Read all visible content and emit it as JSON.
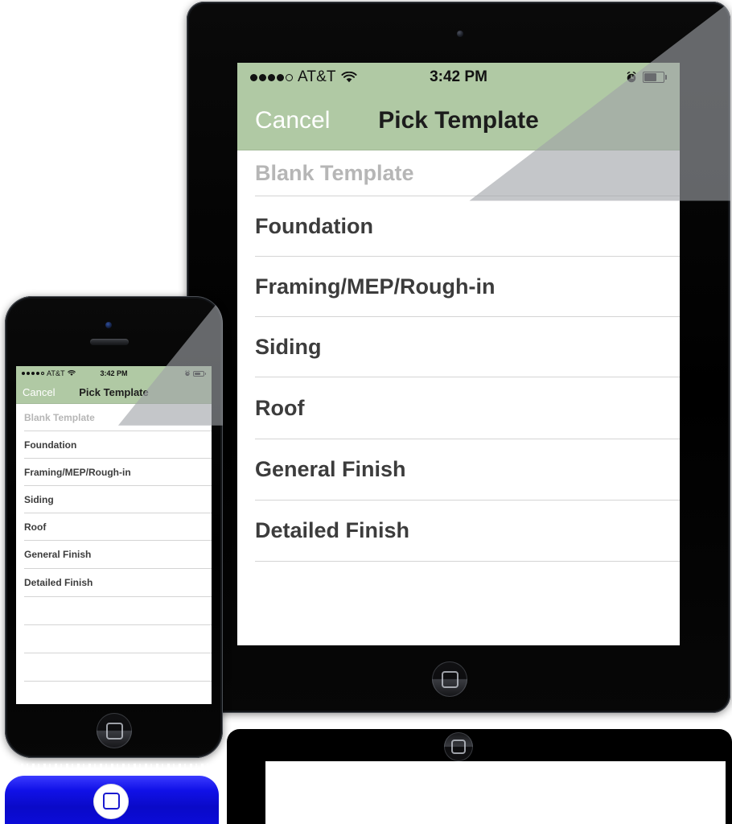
{
  "colors": {
    "navbar_green": "#b0c9a4",
    "row_text": "#3c3c3c",
    "placeholder_text": "#b6b6b6",
    "cancel_text": "#ffffff",
    "separator": "#d4d4d4",
    "device_body": "#000000",
    "reflection_glow_blue": "#0b0bd8"
  },
  "status_bar": {
    "signal_dots_filled": 4,
    "signal_dots_total": 5,
    "carrier": "AT&T",
    "wifi_icon": "wifi-icon",
    "time": "3:42 PM",
    "alarm_icon": "alarm-clock-icon",
    "battery_icon": "battery-icon",
    "battery_percent": 60
  },
  "navbar": {
    "cancel_label": "Cancel",
    "title": "Pick Template"
  },
  "template_list": {
    "rows": [
      {
        "label": "Blank Template",
        "style": "placeholder"
      },
      {
        "label": "Foundation",
        "style": "normal"
      },
      {
        "label": "Framing/MEP/Rough-in",
        "style": "normal"
      },
      {
        "label": "Siding",
        "style": "normal"
      },
      {
        "label": "Roof",
        "style": "normal"
      },
      {
        "label": "General Finish",
        "style": "normal"
      },
      {
        "label": "Detailed Finish",
        "style": "normal"
      }
    ]
  },
  "devices": {
    "tablet": {
      "name": "iPad",
      "home_button_icon": "home-button-icon",
      "camera_icon": "front-camera-icon"
    },
    "phone": {
      "name": "iPhone",
      "home_button_icon": "home-button-icon",
      "camera_icon": "front-camera-icon",
      "speaker_icon": "earpiece-speaker-icon"
    }
  }
}
